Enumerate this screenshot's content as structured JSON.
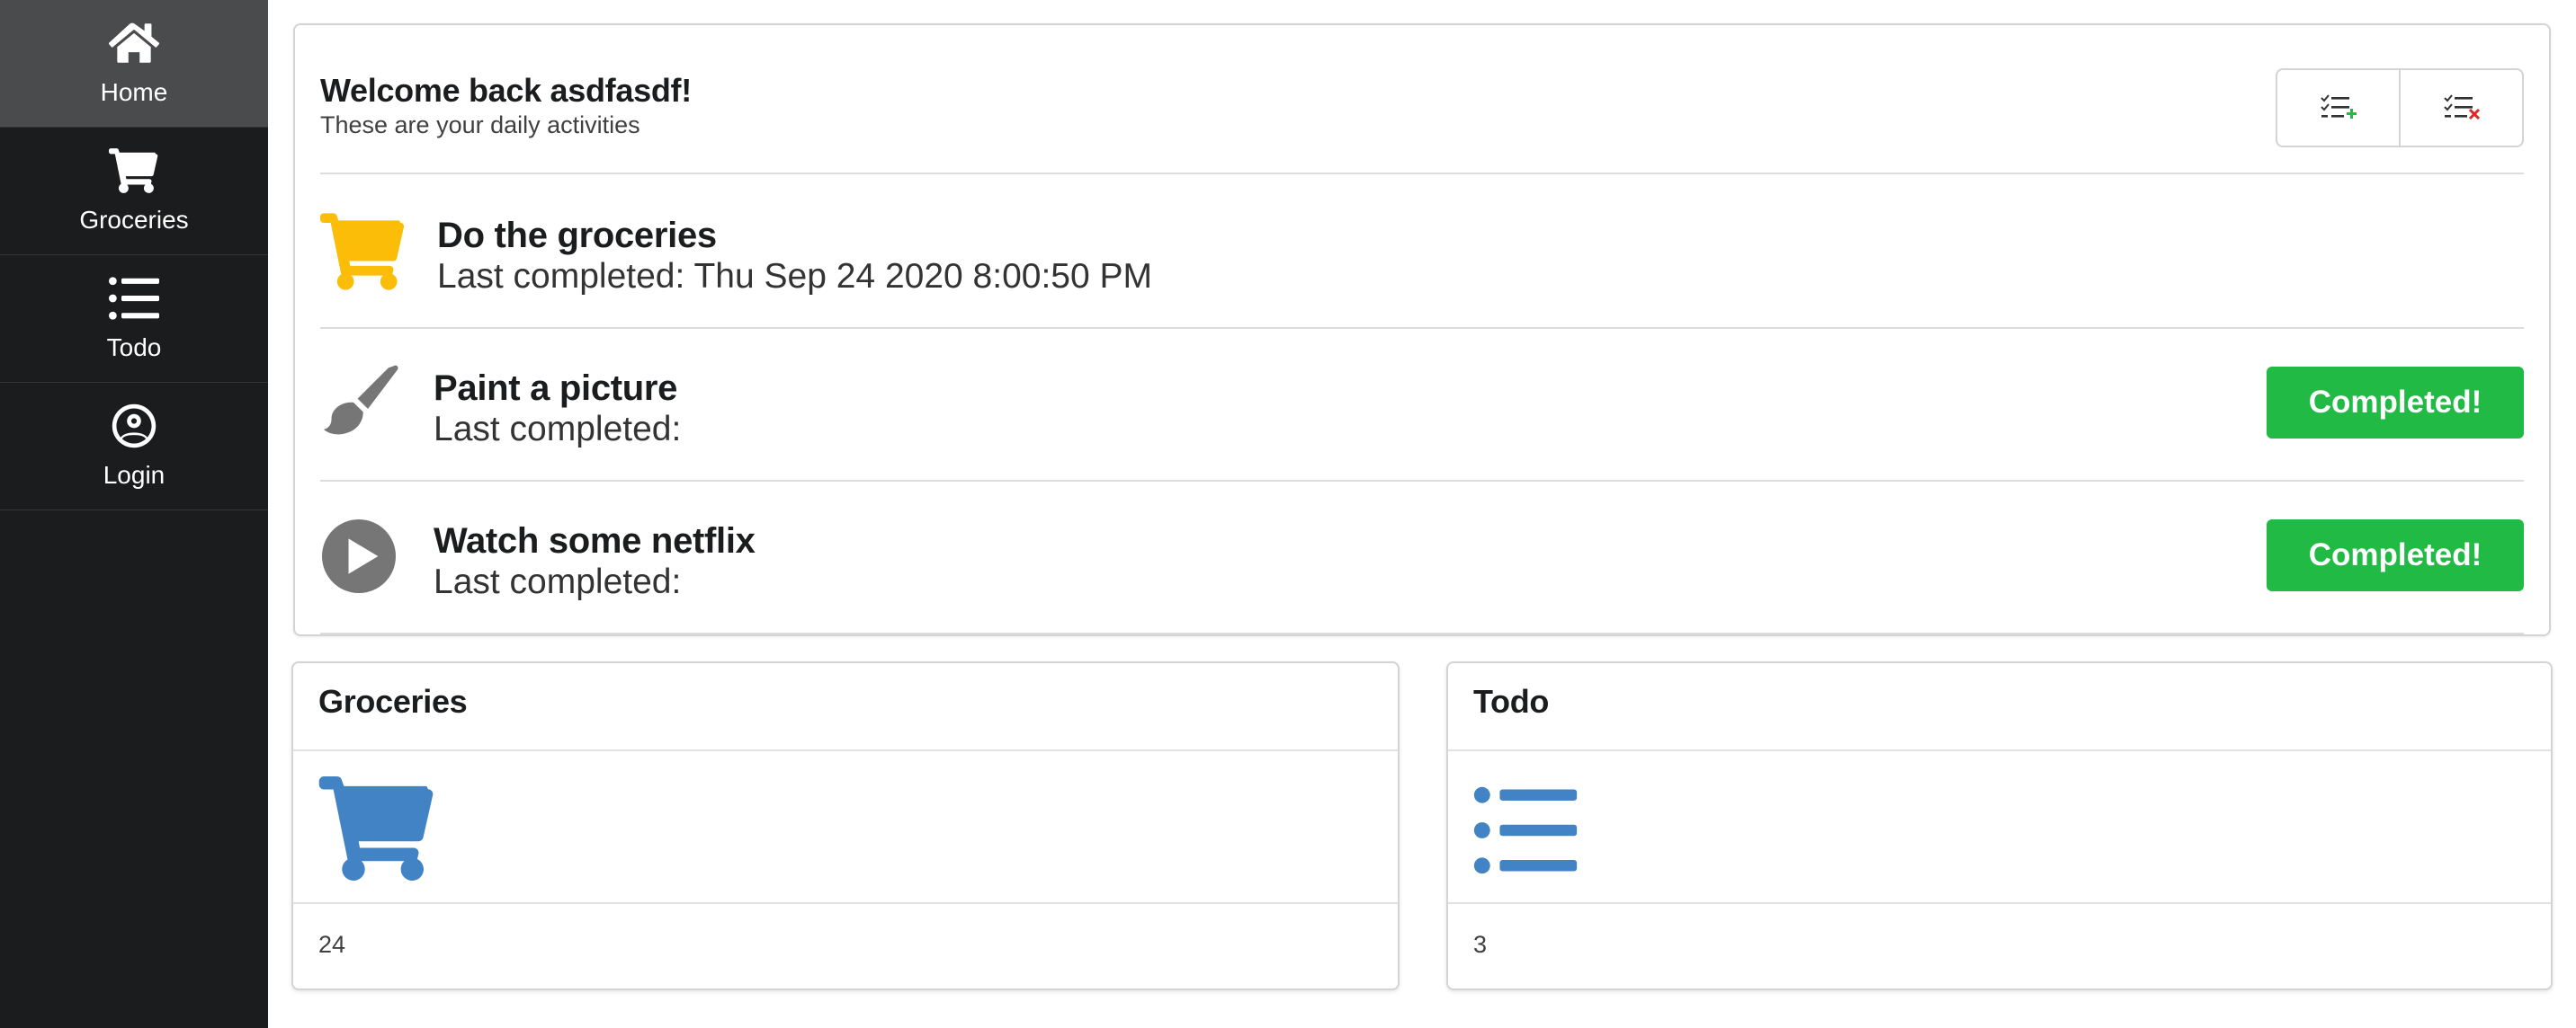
{
  "sidebar": {
    "items": [
      {
        "label": "Home",
        "icon": "home-icon",
        "active": true
      },
      {
        "label": "Groceries",
        "icon": "cart-icon",
        "active": false
      },
      {
        "label": "Todo",
        "icon": "list-icon",
        "active": false
      },
      {
        "label": "Login",
        "icon": "user-circle-icon",
        "active": false
      }
    ]
  },
  "header": {
    "welcome": "Welcome back asdfasdf!",
    "subtitle": "These are your daily activities",
    "buttons": [
      {
        "icon": "add-task-icon",
        "accent": "#21ba45"
      },
      {
        "icon": "remove-task-icon",
        "accent": "#db2828"
      }
    ]
  },
  "activities": [
    {
      "title": "Do the groceries",
      "completed_label": "Last completed:",
      "completed_value": "Thu Sep 24 2020 8:00:50 PM",
      "icon": "cart-icon",
      "icon_color": "#fbbd08",
      "button": null
    },
    {
      "title": "Paint a picture",
      "completed_label": "Last completed:",
      "completed_value": "",
      "icon": "paintbrush-icon",
      "icon_color": "#767676",
      "button": "Completed!"
    },
    {
      "title": "Watch some netflix",
      "completed_label": "Last completed:",
      "completed_value": "",
      "icon": "play-circle-icon",
      "icon_color": "#767676",
      "button": "Completed!"
    }
  ],
  "cards": [
    {
      "title": "Groceries",
      "icon": "cart-icon",
      "count": "24",
      "icon_color": "#4183c4"
    },
    {
      "title": "Todo",
      "icon": "list-icon",
      "count": "3",
      "icon_color": "#4183c4"
    }
  ],
  "colors": {
    "sidebar_bg": "#1b1c1d",
    "sidebar_active": "#4a4b4d",
    "success": "#21ba45",
    "accent_blue": "#4183c4",
    "accent_yellow": "#fbbd08"
  }
}
